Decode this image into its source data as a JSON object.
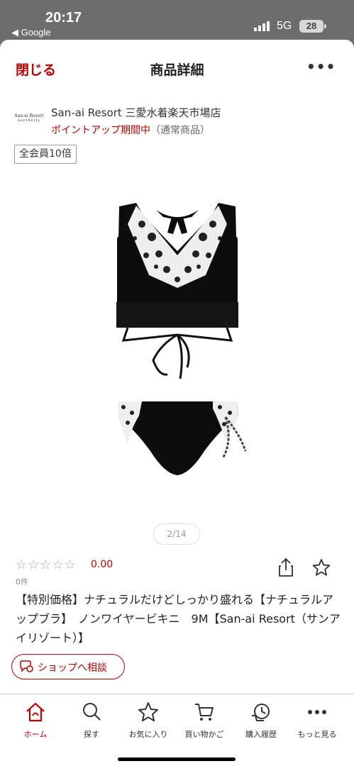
{
  "status_bar": {
    "time": "20:17",
    "back_app": "◀ Google",
    "network": "5G",
    "battery": "28"
  },
  "header": {
    "close_label": "閉じる",
    "title": "商品詳細",
    "more_label": "•••"
  },
  "shop": {
    "logo_line1": "San-ai Resort",
    "logo_line2": "northerly",
    "name": "San-ai Resort 三愛水着楽天市場店",
    "promo_red": "ポイントアップ期間中",
    "promo_gray": "（通常商品）"
  },
  "point_badge": "全会員10倍",
  "gallery": {
    "counter": "2/14"
  },
  "rating": {
    "stars_text": "☆☆☆☆☆",
    "score": "0.00",
    "review_count": "0件"
  },
  "product_title": "【特別価格】ナチュラルだけどしっかり盛れる【ナチュラルアップブラ】　ノンワイヤービキニ　9M【San-ai Resort（サンアイリゾート）】",
  "consult_button": "ショップへ相談",
  "tabs": [
    {
      "label": "ホーム",
      "icon": "home-icon",
      "active": true
    },
    {
      "label": "探す",
      "icon": "search-icon",
      "active": false
    },
    {
      "label": "お気に入り",
      "icon": "star-icon",
      "active": false
    },
    {
      "label": "買い物かご",
      "icon": "cart-icon",
      "active": false
    },
    {
      "label": "購入履歴",
      "icon": "history-icon",
      "active": false
    },
    {
      "label": "もっと見る",
      "icon": "more-icon",
      "active": false
    }
  ],
  "colors": {
    "accent": "#bf0000",
    "status_bg": "#6d6d6d"
  }
}
